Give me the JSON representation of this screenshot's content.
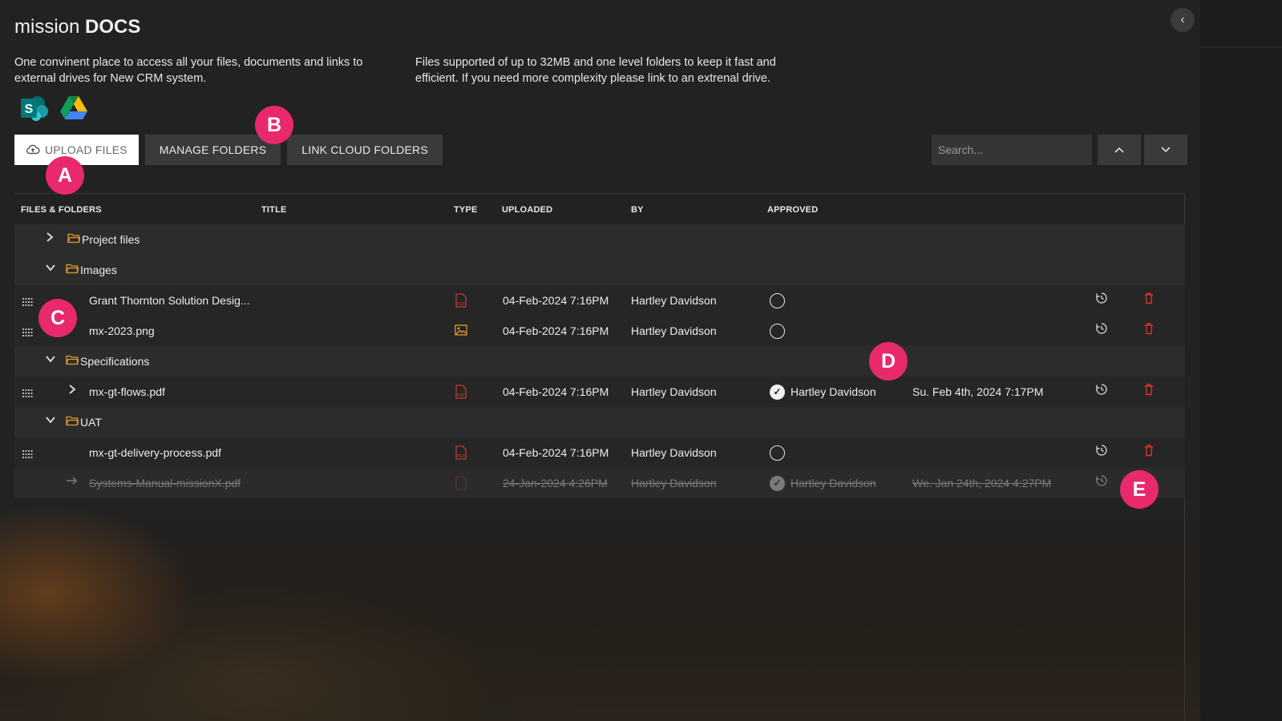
{
  "app": {
    "title_light": "mission",
    "title_bold": "DOCS"
  },
  "description": {
    "left": "One convinent place to access all your files, documents and links to external drives for New CRM system.",
    "right": "Files supported of up to 32MB and one level folders to keep it fast and efficient. If you need more complexity please link to an extrenal drive."
  },
  "brand_logos": [
    {
      "name": "sharepoint-logo",
      "letter": "S"
    },
    {
      "name": "google-drive-logo"
    }
  ],
  "toolbar": {
    "upload_label": "UPLOAD FILES",
    "manage_label": "MANAGE FOLDERS",
    "link_label": "LINK CLOUD FOLDERS"
  },
  "search": {
    "placeholder": "Search..."
  },
  "sort": {
    "up_icon": "chevron-up-icon",
    "down_icon": "chevron-down-icon"
  },
  "table": {
    "headers": {
      "files": "FILES & FOLDERS",
      "title": "TITLE",
      "type": "TYPE",
      "uploaded": "UPLOADED",
      "by": "BY",
      "approved": "APPROVED"
    },
    "rows": [
      {
        "kind": "folder",
        "name": "Project files",
        "expanded": false
      },
      {
        "kind": "folder",
        "name": "Images",
        "expanded": true
      },
      {
        "kind": "file",
        "name": "Grant Thornton Solution Desig...",
        "type": "pdf",
        "uploaded": "04-Feb-2024 7:16PM",
        "by": "Hartley Davidson",
        "approved": false
      },
      {
        "kind": "file",
        "name": "mx-2023.png",
        "type": "image",
        "uploaded": "04-Feb-2024 7:16PM",
        "by": "Hartley Davidson",
        "approved": false
      },
      {
        "kind": "folder",
        "name": "Specifications",
        "expanded": true
      },
      {
        "kind": "file",
        "name": "mx-gt-flows.pdf",
        "type": "pdf",
        "uploaded": "04-Feb-2024 7:16PM",
        "by": "Hartley Davidson",
        "approved": true,
        "approver": "Hartley Davidson",
        "approved_on": "Su. Feb 4th, 2024 7:17PM",
        "has_versions": true
      },
      {
        "kind": "folder",
        "name": "UAT",
        "expanded": true
      },
      {
        "kind": "file",
        "name": "mx-gt-delivery-process.pdf",
        "type": "pdf",
        "uploaded": "04-Feb-2024 7:16PM",
        "by": "Hartley Davidson",
        "approved": false
      },
      {
        "kind": "deleted",
        "name": "Systems-Manual-missionX.pdf",
        "type": "pdf",
        "uploaded": "24-Jan-2024 4:26PM",
        "by": "Hartley Davidson",
        "approved": true,
        "approver": "Hartley Davidson",
        "approved_on": "We. Jan 24th, 2024 4:27PM"
      }
    ]
  },
  "markers": [
    "A",
    "B",
    "C",
    "D",
    "E"
  ],
  "colors": {
    "accent_marker": "#e8296c",
    "pdf_red": "#c0392b",
    "folder_orange": "#e39a2d",
    "trash_red": "#d9342b"
  }
}
